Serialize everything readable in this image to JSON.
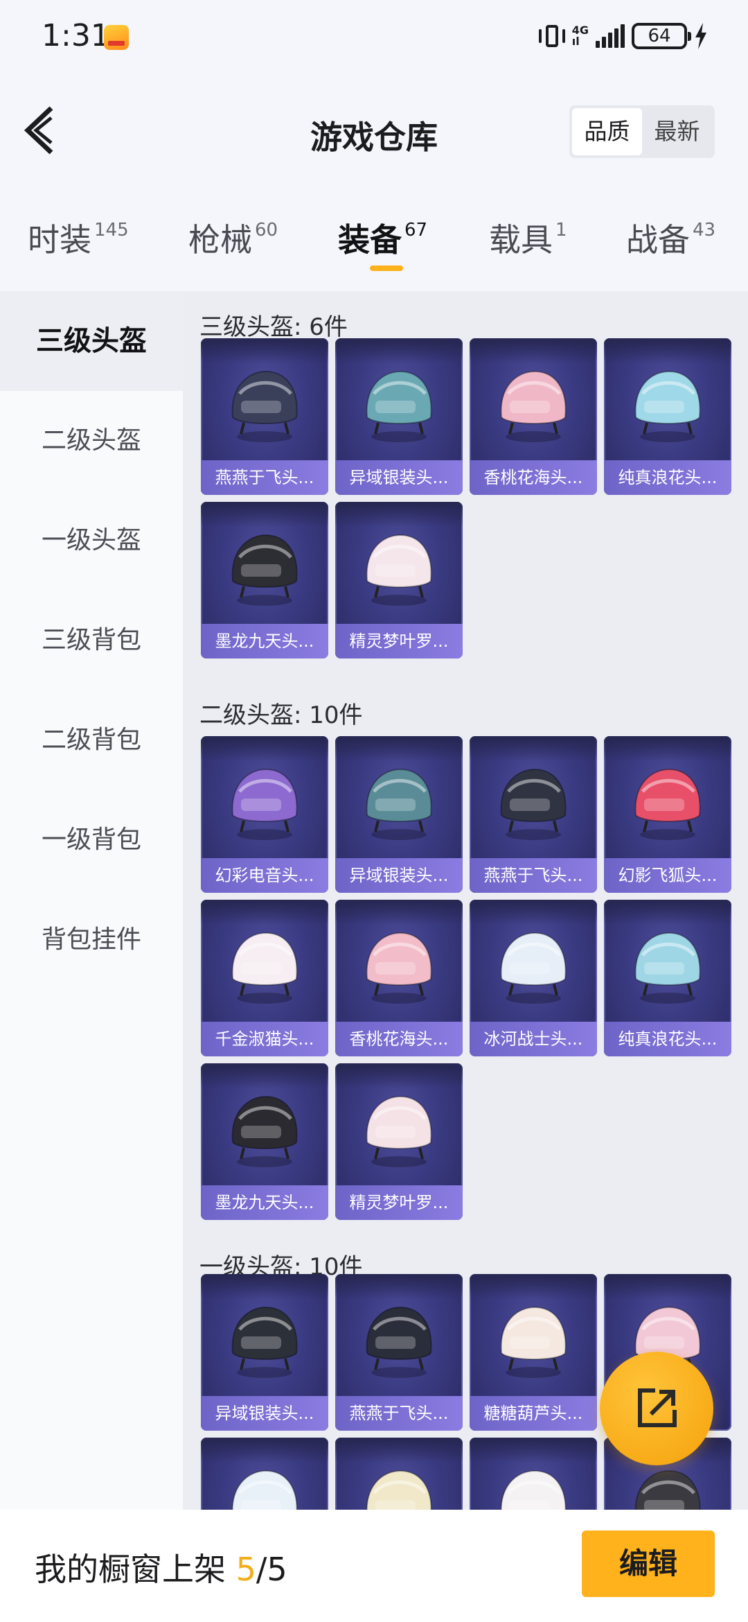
{
  "status_bar": {
    "time": "1:31",
    "network": "4G",
    "battery": "64"
  },
  "header": {
    "title": "游戏仓库",
    "back_icon": "chevron-left-icon"
  },
  "sort": {
    "options": [
      "品质",
      "最新"
    ],
    "active": "品质"
  },
  "categories": [
    {
      "label": "时装",
      "count": "145"
    },
    {
      "label": "枪械",
      "count": "60"
    },
    {
      "label": "装备",
      "count": "67",
      "active": true
    },
    {
      "label": "载具",
      "count": "1"
    },
    {
      "label": "战备",
      "count": "43"
    }
  ],
  "sidebar": {
    "items": [
      "三级头盔",
      "二级头盔",
      "一级头盔",
      "三级背包",
      "二级背包",
      "一级背包",
      "背包挂件"
    ],
    "active": "三级头盔"
  },
  "sections": [
    {
      "title": "三级头盔: 6件",
      "items": [
        {
          "name": "燕燕于飞头...",
          "color": "#3a3f5a"
        },
        {
          "name": "异域银装头...",
          "color": "#6aa8b4"
        },
        {
          "name": "香桃花海头...",
          "color": "#f0b8c6"
        },
        {
          "name": "纯真浪花头...",
          "color": "#9fd8e8"
        },
        {
          "name": "墨龙九天头...",
          "color": "#2d2d34"
        },
        {
          "name": "精灵梦叶罗...",
          "color": "#f4e6ea"
        }
      ]
    },
    {
      "title": "二级头盔: 10件",
      "items": [
        {
          "name": "幻彩电音头...",
          "color": "#8c6ad0"
        },
        {
          "name": "异域银装头...",
          "color": "#5a8c98"
        },
        {
          "name": "燕燕于飞头...",
          "color": "#303442"
        },
        {
          "name": "幻影飞狐头...",
          "color": "#e8506a"
        },
        {
          "name": "千金淑猫头...",
          "color": "#f6eef2"
        },
        {
          "name": "香桃花海头...",
          "color": "#f2bcc8"
        },
        {
          "name": "冰河战士头...",
          "color": "#e6eef8"
        },
        {
          "name": "纯真浪花头...",
          "color": "#9ed6e6"
        },
        {
          "name": "墨龙九天头...",
          "color": "#2a2a30"
        },
        {
          "name": "精灵梦叶罗...",
          "color": "#f4e2e6"
        }
      ]
    },
    {
      "title": "一级头盔: 10件",
      "items": [
        {
          "name": "异域银装头...",
          "color": "#2c3038"
        },
        {
          "name": "燕燕于飞头...",
          "color": "#2a2d3a"
        },
        {
          "name": "糖糖葫芦头...",
          "color": "#f4e8e0"
        },
        {
          "name": "",
          "color": "#f2c8d6"
        },
        {
          "name": "",
          "color": "#e8f0f8"
        },
        {
          "name": "",
          "color": "#f0e8c8"
        },
        {
          "name": "",
          "color": "#f4f2f2"
        },
        {
          "name": "",
          "color": "#3a3a40"
        }
      ]
    }
  ],
  "bottom_bar": {
    "prefix": "我的橱窗上架 ",
    "current": "5",
    "total": "/5",
    "edit_label": "编辑"
  },
  "colors": {
    "accent": "#ffb21c",
    "card_bg": "#3a3a82",
    "card_label": "#7a6ed8"
  }
}
